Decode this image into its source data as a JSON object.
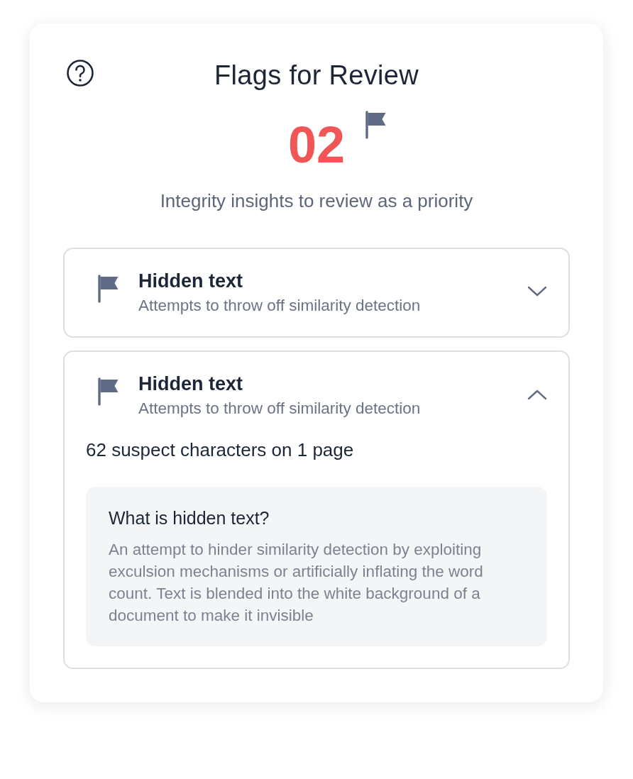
{
  "header": {
    "title": "Flags for Review",
    "count": "02",
    "subtitle": "Integrity insights to review as a priority"
  },
  "flags": [
    {
      "title": "Hidden text",
      "description": "Attempts to throw off similarity detection",
      "expanded": false
    },
    {
      "title": "Hidden text",
      "description": "Attempts to throw off similarity detection",
      "expanded": true,
      "summary": "62 suspect characters on 1 page",
      "info": {
        "heading": "What is hidden text?",
        "body": "An attempt to hinder similarity detection by exploiting exculsion mechanisms or artificially inflating the word count. Text is blended into the white background of a document to make it invisible"
      }
    }
  ]
}
